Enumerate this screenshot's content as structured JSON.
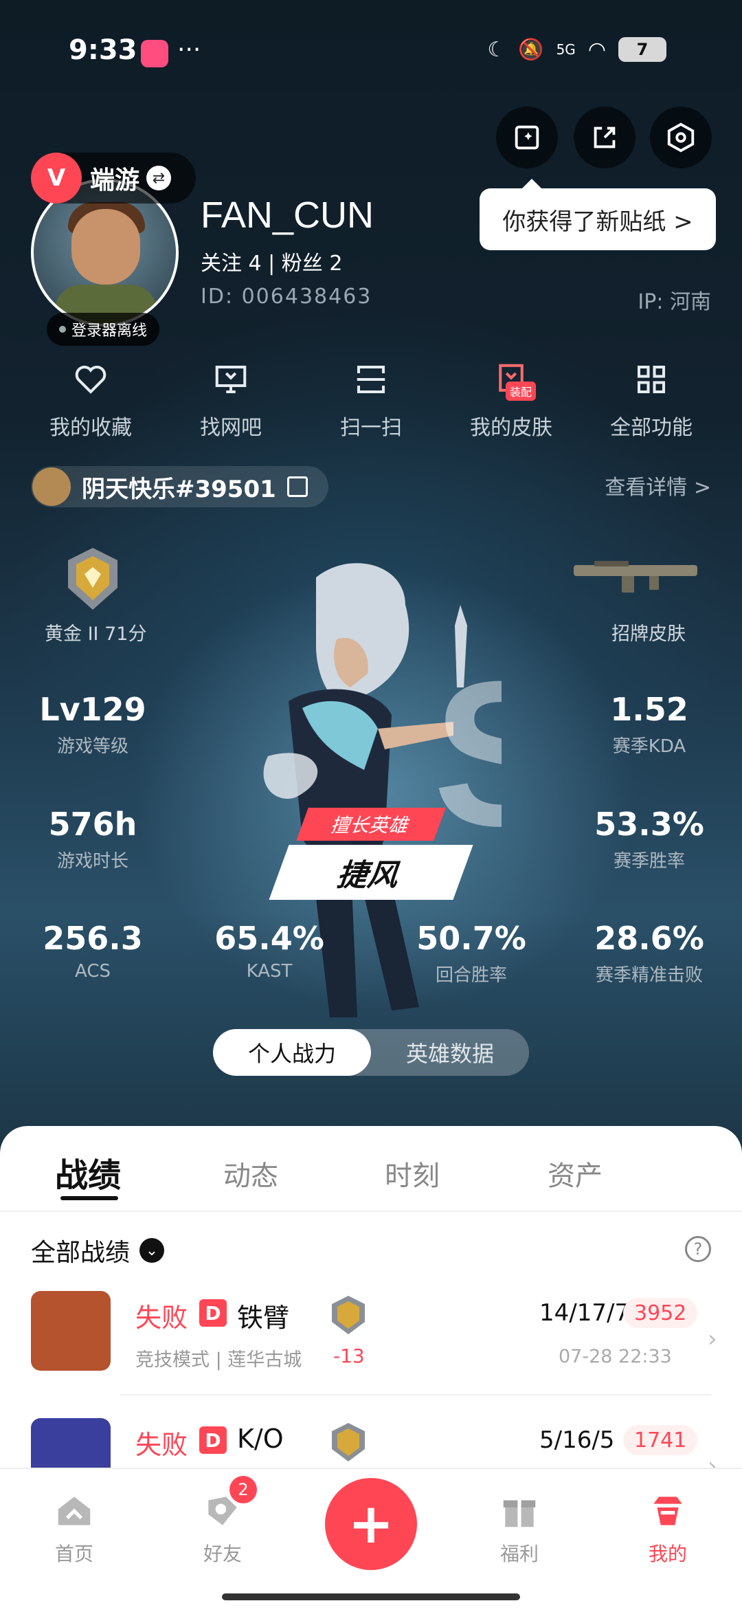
{
  "status_bar": {
    "time": "9:33",
    "dots": "···",
    "network": "5G",
    "battery": "7"
  },
  "sticker_tooltip": "你获得了新贴纸 >",
  "profile": {
    "game": "端游",
    "game_logo_letter": "V",
    "offline_status": "登录器离线",
    "username": "FAN_CUN",
    "follow": "关注 4  |  粉丝 2",
    "id": "ID:  006438463",
    "ip": "IP:  河南"
  },
  "actions": [
    {
      "label": "我的收藏",
      "icon": "heart-icon"
    },
    {
      "label": "找网吧",
      "icon": "monitor-icon"
    },
    {
      "label": "扫一扫",
      "icon": "scan-icon"
    },
    {
      "label": "我的皮肤",
      "icon": "skin-icon",
      "badge": "装配"
    },
    {
      "label": "全部功能",
      "icon": "grid-icon"
    }
  ],
  "account": {
    "name": "阴天快乐#39501",
    "view_detail": "查看详情 >"
  },
  "stats": {
    "rank_label": "黄金 II 71分",
    "signature_skin_label": "招牌皮肤",
    "level": {
      "value": "Lv129",
      "label": "游戏等级"
    },
    "kda": {
      "value": "1.52",
      "label": "赛季KDA"
    },
    "hours": {
      "value": "576h",
      "label": "游戏时长"
    },
    "winrate": {
      "value": "53.3%",
      "label": "赛季胜率"
    },
    "acs": {
      "value": "256.3",
      "label": "ACS"
    },
    "kast": {
      "value": "65.4%",
      "label": "KAST"
    },
    "round_winrate": {
      "value": "50.7%",
      "label": "回合胜率"
    },
    "headshot": {
      "value": "28.6%",
      "label": "赛季精准击败"
    }
  },
  "main_hero": {
    "tag": "擅长英雄",
    "name": "捷风"
  },
  "toggle": {
    "active": "个人战力",
    "inactive": "英雄数据"
  },
  "tabs": [
    "战绩",
    "动态",
    "时刻",
    "资产"
  ],
  "filter": {
    "label": "全部战绩",
    "help": "?"
  },
  "matches": [
    {
      "result": "失败",
      "grade": "D",
      "agent": "铁臂",
      "mode": "竞技模式 | 莲华古城",
      "delta": "-13",
      "kda": "14/17/7",
      "score": "3952",
      "time": "07-28 22:33",
      "avatar_color": "#b5532e"
    },
    {
      "result": "失败",
      "grade": "D",
      "agent": "K/O",
      "mode": "",
      "delta": "",
      "kda": "5/16/5",
      "score": "1741",
      "time": "",
      "avatar_color": "#3a3f9e"
    }
  ],
  "nav": [
    {
      "label": "首页",
      "icon": "home-icon"
    },
    {
      "label": "好友",
      "icon": "friends-icon",
      "badge": "2"
    },
    {
      "label": "福利",
      "icon": "gift-icon"
    },
    {
      "label": "我的",
      "icon": "profile-icon"
    }
  ],
  "colors": {
    "accent": "#ff4655"
  }
}
